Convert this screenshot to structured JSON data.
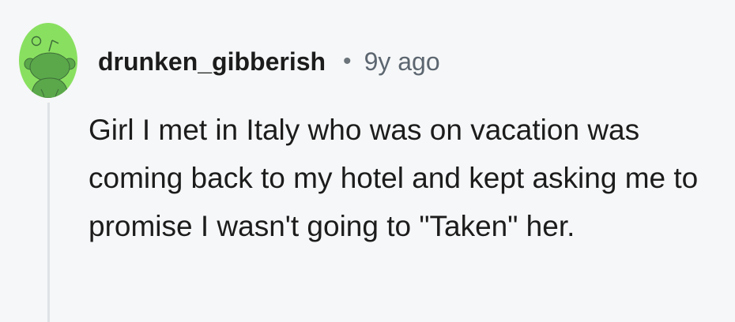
{
  "comment": {
    "avatar_icon": "reddit-snoo-avatar-icon",
    "avatar_color": "#89e060",
    "username": "drunken_gibberish",
    "separator": "•",
    "timestamp": "9y ago",
    "body": "Girl I met in Italy who was on vacation was coming back to my hotel and kept asking me to promise I wasn't going to \"Taken\" her."
  }
}
